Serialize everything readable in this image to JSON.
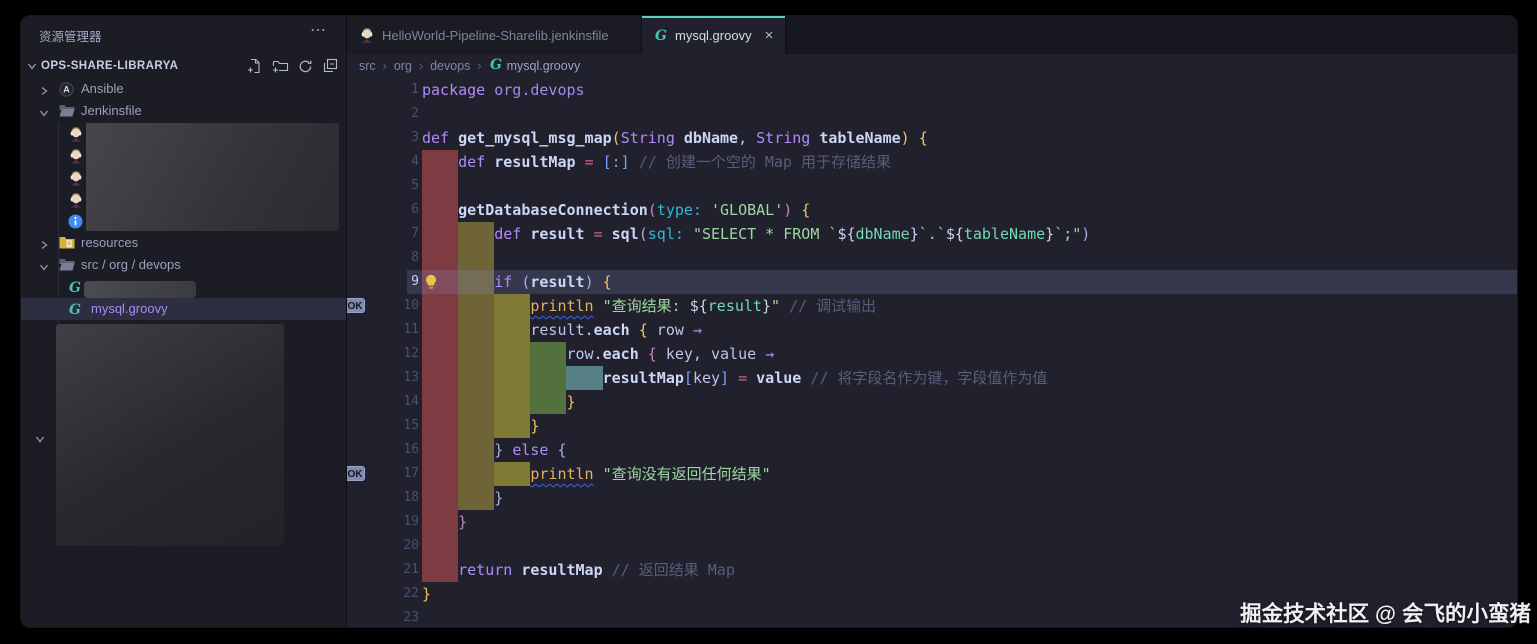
{
  "sidebar": {
    "header_title": "资源管理器",
    "header_menu_icon": "more-horizontal-icon",
    "section_label": "OPS-SHARE-LIBRARYA",
    "section_actions": [
      {
        "name": "new-file-icon"
      },
      {
        "name": "new-folder-icon"
      },
      {
        "name": "refresh-icon"
      },
      {
        "name": "collapse-all-icon"
      }
    ],
    "tree": [
      {
        "label": "Ansible",
        "kind": "folder",
        "state": "collapsed",
        "icon": "ansible-icon"
      },
      {
        "label": "Jenkinsfile",
        "kind": "folder",
        "state": "expanded",
        "icon": "folder-open-icon"
      },
      {
        "label": "",
        "kind": "file",
        "icon": "jenkins-avatar-icon",
        "redacted": true
      },
      {
        "label": "",
        "kind": "file",
        "icon": "jenkins-avatar-icon",
        "redacted": true
      },
      {
        "label": "",
        "kind": "file",
        "icon": "jenkins-avatar-icon",
        "redacted": true
      },
      {
        "label": "",
        "kind": "file",
        "icon": "jenkins-avatar-icon",
        "redacted": true
      },
      {
        "label": "",
        "kind": "file",
        "icon": "info-icon",
        "redacted": true
      },
      {
        "label": "resources",
        "kind": "folder",
        "state": "collapsed",
        "icon": "folder-resources-icon"
      },
      {
        "label": "src / org / devops",
        "kind": "folder",
        "state": "expanded",
        "icon": "folder-open-icon"
      },
      {
        "label": "",
        "kind": "file",
        "icon": "groovy-icon",
        "redacted": true
      },
      {
        "label": "mysql.groovy",
        "kind": "file",
        "icon": "groovy-icon",
        "selected": true
      }
    ]
  },
  "tabs": [
    {
      "label": "HelloWorld-Pipeline-Sharelib.jenkinsfile",
      "icon": "jenkins-avatar-icon",
      "active": false
    },
    {
      "label": "mysql.groovy",
      "icon": "groovy-icon",
      "active": true,
      "close_icon": "×"
    }
  ],
  "breadcrumb": {
    "separator": "›",
    "items": [
      {
        "label": "src"
      },
      {
        "label": "org"
      },
      {
        "label": "devops"
      },
      {
        "label": "mysql.groovy",
        "icon": "groovy-icon"
      }
    ]
  },
  "editor": {
    "line_count": 23,
    "current_line": 9,
    "lightbulb_line": 9,
    "ok_badge": {
      "label": "OK",
      "lines": [
        10,
        17
      ]
    },
    "indent_bands": [
      {
        "col": 0,
        "from": 4,
        "to": 21,
        "color": "#7e3c42"
      },
      {
        "col": 4,
        "from": 7,
        "to": 18,
        "color": "#6f6338"
      },
      {
        "col": 8,
        "from": 10,
        "to": 15,
        "color": "#7f7a33"
      },
      {
        "col": 8,
        "from": 17,
        "to": 17,
        "color": "#7f7a33"
      },
      {
        "col": 12,
        "from": 12,
        "to": 14,
        "color": "#53713d"
      },
      {
        "col": 16,
        "from": 13,
        "to": 13,
        "color": "#567f86"
      }
    ],
    "colors": {
      "accent_teal": "#5ad4c0",
      "keyword_purple": "#b18af8",
      "string_green": "#9ed79f",
      "comment_gray": "#585d7a",
      "parameter_cyan": "#2fb6d8",
      "operator_red": "#db5f7d",
      "bracket_gold": "#f2c55f",
      "bracket_blue": "#7aa2f7",
      "bracket_pink": "#c586c0"
    },
    "lines": [
      {
        "n": 1,
        "segs": [
          [
            "package ",
            "kw"
          ],
          [
            "org.devops",
            "pkg"
          ]
        ]
      },
      {
        "n": 2,
        "segs": []
      },
      {
        "n": 3,
        "segs": [
          [
            "def ",
            "kw"
          ],
          [
            "get_mysql_msg_map",
            "fn"
          ],
          [
            "(",
            "g"
          ],
          [
            "String ",
            "kw"
          ],
          [
            "dbName",
            "fn"
          ],
          [
            ", ",
            "id"
          ],
          [
            "String ",
            "kw"
          ],
          [
            "tableName",
            "fn"
          ],
          [
            ") {",
            "g"
          ]
        ]
      },
      {
        "n": 4,
        "segs": [
          [
            "    ",
            "id"
          ],
          [
            "def ",
            "kw"
          ],
          [
            "resultMap",
            "fn"
          ],
          [
            " ",
            "id"
          ],
          [
            "=",
            "op"
          ],
          [
            " ",
            "id"
          ],
          [
            "[:]",
            "bl"
          ],
          [
            " ",
            "id"
          ],
          [
            "// 创建一个空的 Map 用于存储结果",
            "com"
          ]
        ]
      },
      {
        "n": 5,
        "segs": []
      },
      {
        "n": 6,
        "segs": [
          [
            "    ",
            "id"
          ],
          [
            "getDatabaseConnection",
            "fn"
          ],
          [
            "(",
            "p"
          ],
          [
            "type: ",
            "prop"
          ],
          [
            "'GLOBAL'",
            "str"
          ],
          [
            ")",
            "p"
          ],
          [
            " {",
            "g"
          ]
        ]
      },
      {
        "n": 7,
        "segs": [
          [
            "        ",
            "id"
          ],
          [
            "def ",
            "kw"
          ],
          [
            "result",
            "fn"
          ],
          [
            " ",
            "id"
          ],
          [
            "=",
            "op"
          ],
          [
            " ",
            "id"
          ],
          [
            "sql",
            "fn"
          ],
          [
            "(",
            "lav"
          ],
          [
            "sql: ",
            "prop"
          ],
          [
            "\"SELECT * FROM `",
            "str"
          ],
          [
            "${",
            "pale"
          ],
          [
            "dbName",
            "mint"
          ],
          [
            "}",
            "pale"
          ],
          [
            "`.`",
            "str"
          ],
          [
            "${",
            "pale"
          ],
          [
            "tableName",
            "mint"
          ],
          [
            "}",
            "pale"
          ],
          [
            "`;\"",
            "str"
          ],
          [
            ")",
            "lav"
          ]
        ]
      },
      {
        "n": 8,
        "segs": []
      },
      {
        "n": 9,
        "segs": [
          [
            "        ",
            "id"
          ],
          [
            "if ",
            "kw"
          ],
          [
            "(",
            "lav"
          ],
          [
            "result",
            "fn"
          ],
          [
            ")",
            "lav"
          ],
          [
            " {",
            "g"
          ]
        ]
      },
      {
        "n": 10,
        "segs": [
          [
            "            ",
            "id"
          ],
          [
            "println",
            "ylw u"
          ],
          [
            " ",
            "id"
          ],
          [
            "\"查询结果: ",
            "str"
          ],
          [
            "${",
            "pale"
          ],
          [
            "result",
            "mint"
          ],
          [
            "}",
            "pale"
          ],
          [
            "\"",
            "str"
          ],
          [
            " ",
            "id"
          ],
          [
            "// 调试输出",
            "com"
          ]
        ]
      },
      {
        "n": 11,
        "segs": [
          [
            "            ",
            "id"
          ],
          [
            "result",
            "id"
          ],
          [
            ".",
            "pale"
          ],
          [
            "each",
            "fn"
          ],
          [
            " ",
            "id"
          ],
          [
            "{",
            "g"
          ],
          [
            " row ",
            "id"
          ],
          [
            "→",
            "kw"
          ]
        ]
      },
      {
        "n": 12,
        "segs": [
          [
            "                ",
            "id"
          ],
          [
            "row",
            "id"
          ],
          [
            ".",
            "pale"
          ],
          [
            "each",
            "fn"
          ],
          [
            " ",
            "id"
          ],
          [
            "{",
            "p"
          ],
          [
            " key, value ",
            "id"
          ],
          [
            "→",
            "kw"
          ]
        ]
      },
      {
        "n": 13,
        "segs": [
          [
            "                    ",
            "id"
          ],
          [
            "resultMap",
            "fn"
          ],
          [
            "[",
            "bl"
          ],
          [
            "key",
            "id"
          ],
          [
            "]",
            "bl"
          ],
          [
            " ",
            "id"
          ],
          [
            "=",
            "op"
          ],
          [
            " ",
            "id"
          ],
          [
            "value",
            "fn"
          ],
          [
            " ",
            "id"
          ],
          [
            "// 将字段名作为键，字段值作为值",
            "com"
          ]
        ]
      },
      {
        "n": 14,
        "segs": [
          [
            "                ",
            "id"
          ],
          [
            "}",
            "g"
          ]
        ]
      },
      {
        "n": 15,
        "segs": [
          [
            "            ",
            "id"
          ],
          [
            "}",
            "g"
          ]
        ]
      },
      {
        "n": 16,
        "segs": [
          [
            "        ",
            "id"
          ],
          [
            "} ",
            "lav"
          ],
          [
            "else",
            "kw"
          ],
          [
            " {",
            "lav"
          ]
        ]
      },
      {
        "n": 17,
        "segs": [
          [
            "            ",
            "id"
          ],
          [
            "println",
            "ylw u"
          ],
          [
            " ",
            "id"
          ],
          [
            "\"查询没有返回任何结果\"",
            "str"
          ]
        ]
      },
      {
        "n": 18,
        "segs": [
          [
            "        ",
            "id"
          ],
          [
            "}",
            "lav"
          ]
        ]
      },
      {
        "n": 19,
        "segs": [
          [
            "    ",
            "id"
          ],
          [
            "}",
            "p"
          ]
        ]
      },
      {
        "n": 20,
        "segs": []
      },
      {
        "n": 21,
        "segs": [
          [
            "    ",
            "id"
          ],
          [
            "return ",
            "kw"
          ],
          [
            "resultMap",
            "fn"
          ],
          [
            " ",
            "id"
          ],
          [
            "// 返回结果 Map",
            "com"
          ]
        ]
      },
      {
        "n": 22,
        "segs": [
          [
            "}",
            "g"
          ]
        ]
      },
      {
        "n": 23,
        "segs": []
      }
    ]
  },
  "watermark": "掘金技术社区 @ 会飞的小蛮猪"
}
